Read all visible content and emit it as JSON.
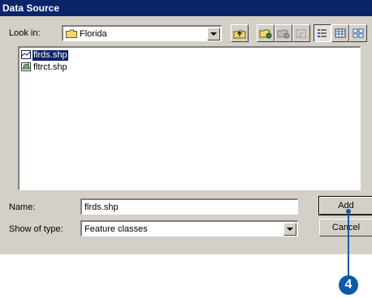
{
  "window": {
    "title": "Data Source"
  },
  "look_in": {
    "label": "Look in:",
    "value": "Florida"
  },
  "toolbar": {
    "buttons": [
      "up-one-level-icon",
      "connect-folder-icon",
      "disconnect-folder-icon",
      "properties-icon",
      "list-view-icon",
      "details-view-icon",
      "thumbnails-view-icon"
    ]
  },
  "files": [
    {
      "name": "flrds.shp",
      "icon": "line-shapefile-icon",
      "selected": true
    },
    {
      "name": "fltrct.shp",
      "icon": "polygon-shapefile-icon",
      "selected": false
    }
  ],
  "name_field": {
    "label": "Name:",
    "value": "flrds.shp"
  },
  "type_field": {
    "label": "Show of type:",
    "value": "Feature classes"
  },
  "buttons": {
    "add": "Add",
    "cancel": "Cancel"
  },
  "callout": {
    "number": "4"
  },
  "colors": {
    "title_bar": "#0a246a",
    "dialog_bg": "#d4d0c8",
    "callout": "#0b5aa8"
  }
}
